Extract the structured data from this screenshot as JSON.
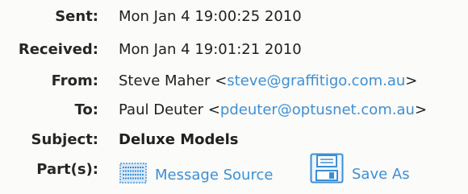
{
  "headers": {
    "sent": {
      "label": "Sent:",
      "value": "Mon Jan 4 19:00:25 2010"
    },
    "received": {
      "label": "Received:",
      "value": "Mon Jan 4 19:01:21 2010"
    },
    "from": {
      "label": "From:",
      "name": "Steve Maher",
      "open": "<",
      "email": "steve@graffitigo.com.au",
      "close": ">"
    },
    "to": {
      "label": "To:",
      "name": "Paul Deuter",
      "open": "<",
      "email": "pdeuter@optusnet.com.au",
      "close": ">"
    },
    "subject": {
      "label": "Subject:",
      "value": "Deluxe Models"
    },
    "parts": {
      "label": "Part(s):"
    }
  },
  "attachments": [
    {
      "label": "Message Source",
      "icon": "document-grid-icon"
    },
    {
      "label": "Save As",
      "icon": "floppy-disk-icon"
    }
  ],
  "colors": {
    "link": "#3d8fd4",
    "text": "#202020",
    "background": "#fbfbfa"
  }
}
